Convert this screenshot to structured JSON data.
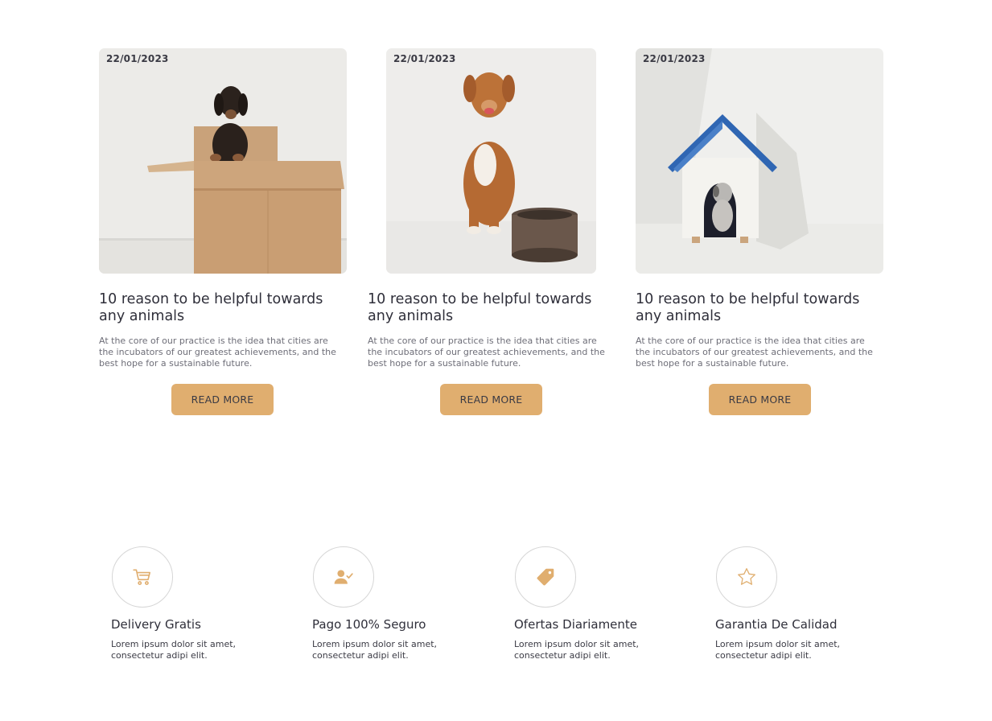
{
  "posts": [
    {
      "date": "22/01/2023",
      "image": "dachshund-in-cardboard-box",
      "title": "10 reason to be helpful towards any animals",
      "excerpt": "At the core of our practice is the idea that cities are the incubators of our greatest achievements, and the best hope for a sustainable future.",
      "button_label": "READ MORE"
    },
    {
      "date": "22/01/2023",
      "image": "dog-with-food-bowl",
      "title": "10 reason to be helpful towards any animals",
      "excerpt": "At the core of our practice is the idea that cities are the incubators of our greatest achievements, and the best hope for a sustainable future.",
      "button_label": "READ MORE"
    },
    {
      "date": "22/01/2023",
      "image": "puppy-in-doghouse",
      "title": "10 reason to be helpful towards any animals",
      "excerpt": "At the core of our practice is the idea that cities are the incubators of our greatest achievements, and the best hope for a sustainable future.",
      "button_label": "READ MORE"
    }
  ],
  "features": [
    {
      "icon": "cart-icon",
      "title": "Delivery Gratis",
      "text": "Lorem ipsum dolor sit amet, consectetur adipi elit."
    },
    {
      "icon": "user-check-icon",
      "title": "Pago 100% Seguro",
      "text": "Lorem ipsum dolor sit amet, consectetur adipi elit."
    },
    {
      "icon": "tag-icon",
      "title": "Ofertas Diariamente",
      "text": "Lorem ipsum dolor sit amet, consectetur adipi elit."
    },
    {
      "icon": "star-icon",
      "title": "Garantia De Calidad",
      "text": "Lorem ipsum dolor sit amet, consectetur adipi elit."
    }
  ],
  "colors": {
    "accent": "#e0ae6f",
    "text_dark": "#2f2f3a",
    "text_muted": "#6e6e78"
  }
}
